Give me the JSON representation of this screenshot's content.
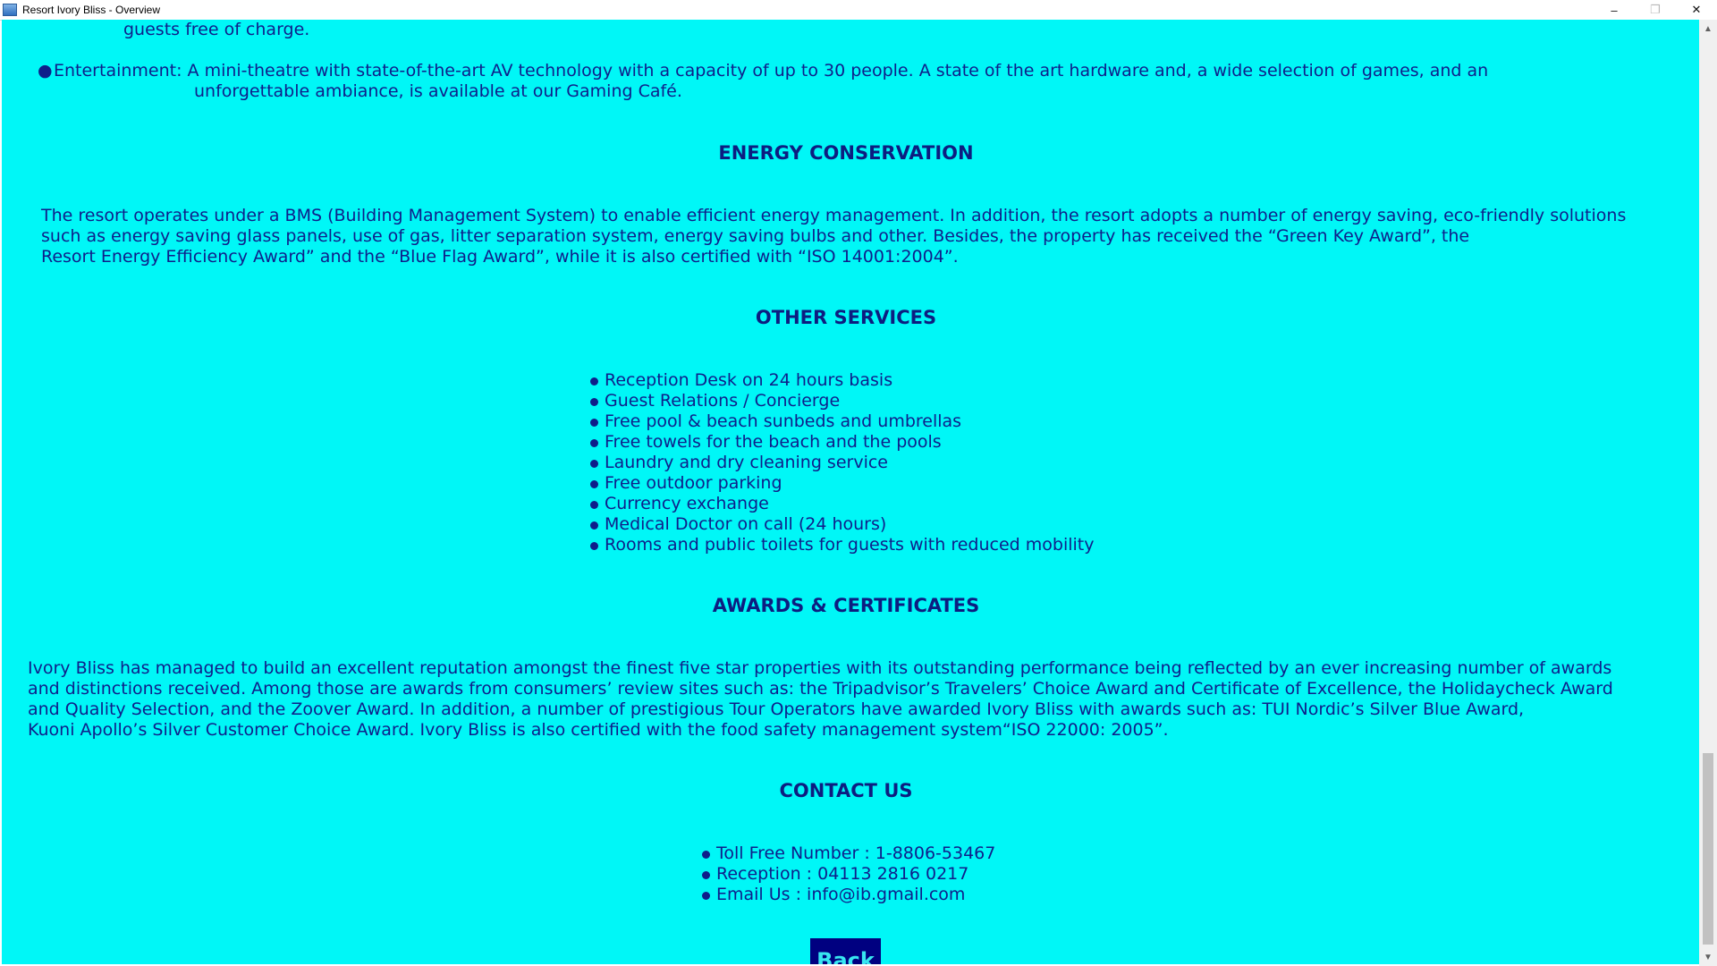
{
  "window": {
    "title": "Resort Ivory Bliss - Overview",
    "controls": {
      "minimize": "–",
      "restore": "❐",
      "close": "✕"
    }
  },
  "colors": {
    "background": "#00f7f7",
    "text": "#0f1e8a",
    "button_bg": "#000080",
    "button_text": "#37e6f0"
  },
  "facilities": {
    "previous_tail": "guests free of charge.",
    "entertainment_line1": "Entertainment: A mini-theatre with state-of-the-art AV technology with a capacity of up to 30 people. A  state of the art hardware and, a wide selection of games, and an",
    "entertainment_line2": "unforgettable ambiance, is available at our Gaming Café."
  },
  "energy": {
    "heading": "ENERGY CONSERVATION",
    "lines": [
      "The resort operates under a BMS (Building Management System) to enable efficient energy management. In addition, the resort adopts a number of energy saving, eco-friendly solutions",
      "such as energy saving glass panels, use of gas, litter separation system, energy saving bulbs and other. Besides, the property has received the “Green Key Award”, the",
      "Resort Energy Efficiency Award” and the “Blue Flag Award”, while it is also certified with “ISO 14001:2004”."
    ]
  },
  "services": {
    "heading": "OTHER SERVICES",
    "items": [
      "Reception Desk on 24 hours basis",
      "Guest Relations / Concierge",
      "Free pool & beach sunbeds and umbrellas",
      "Free towels for the beach and the pools",
      "Laundry and dry cleaning service",
      "Free outdoor parking",
      "Currency exchange",
      "Medical Doctor on call (24 hours)",
      "Rooms and public toilets for guests with reduced mobility"
    ]
  },
  "awards": {
    "heading": "AWARDS & CERTIFICATES",
    "lines": [
      "Ivory Bliss has managed to build an excellent reputation amongst the finest five star properties with its outstanding performance being reflected by an ever increasing number of awards",
      "and distinctions received. Among those are awards from consumers’ review sites such as: the Tripadvisor’s Travelers’ Choice Award and Certificate of Excellence, the Holidaycheck Award",
      "and Quality Selection, and the Zoover Award. In addition, a number of prestigious Tour Operators have awarded Ivory Bliss with awards such as: TUI Nordic’s Silver Blue Award,",
      "Kuoni Apollo’s Silver Customer Choice Award. Ivory Bliss is also certified with the food safety management system“ISO 22000: 2005”."
    ]
  },
  "contact": {
    "heading": "CONTACT US",
    "items": [
      "Toll Free Number : 1-8806-53467",
      "Reception :  04113 2816 0217",
      "Email Us : info@ib.gmail.com"
    ]
  },
  "back_label": "Back",
  "scrollbar": {
    "up_arrow": "▲",
    "down_arrow": "▼"
  }
}
